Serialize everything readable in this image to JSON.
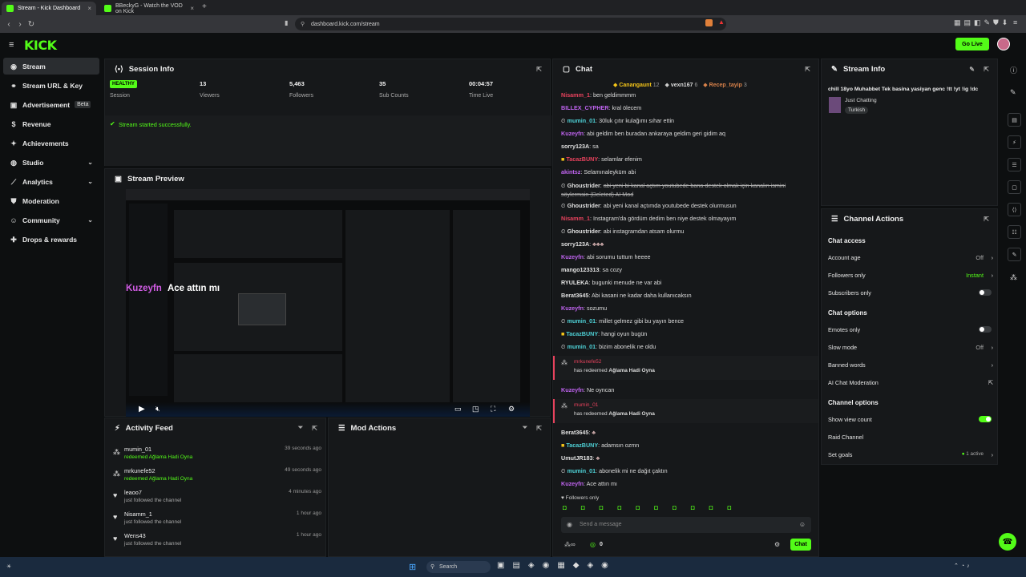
{
  "browser": {
    "tabs": [
      {
        "label": "Stream - Kick Dashboard"
      },
      {
        "label": "BBeckyG - Watch the VOD on Kick"
      }
    ],
    "url": "dashboard.kick.com/stream"
  },
  "header": {
    "logo": "KICK",
    "go_live": "Go Live"
  },
  "sidebar": {
    "items": [
      {
        "label": "Stream"
      },
      {
        "label": "Stream URL & Key"
      },
      {
        "label": "Advertisement",
        "badge": "Beta"
      },
      {
        "label": "Revenue"
      },
      {
        "label": "Achievements"
      },
      {
        "label": "Studio"
      },
      {
        "label": "Analytics"
      },
      {
        "label": "Moderation"
      },
      {
        "label": "Community"
      },
      {
        "label": "Drops & rewards"
      }
    ]
  },
  "session": {
    "title": "Session Info",
    "status_badge": "HEALTHY",
    "status_label": "Session",
    "viewers": "13",
    "viewers_label": "Viewers",
    "followers": "5,463",
    "followers_label": "Followers",
    "subs": "35",
    "subs_label": "Sub Counts",
    "time": "00:04:57",
    "time_label": "Time Live",
    "message": "Stream started successfully."
  },
  "preview": {
    "title": "Stream Preview",
    "overlay_user": "Kuzeyfn",
    "overlay_text": "Ace attın mı"
  },
  "activity": {
    "title": "Activity Feed",
    "items": [
      {
        "name": "mumin_01",
        "sub": "redeemed Ağlama Hadi Oyna",
        "time": "39 seconds ago"
      },
      {
        "name": "mrkunefe52",
        "sub": "redeemed Ağlama Hadi Oyna",
        "time": "49 seconds ago"
      },
      {
        "name": "leaoo7",
        "sub": "just followed the channel",
        "time": "4 minutes ago"
      },
      {
        "name": "Nisamm_1",
        "sub": "just followed the channel",
        "time": "1 hour ago"
      },
      {
        "name": "Wens43",
        "sub": "just followed the channel",
        "time": "1 hour ago"
      }
    ]
  },
  "mod": {
    "title": "Mod Actions"
  },
  "chat": {
    "title": "Chat",
    "top_gifters": [
      {
        "name": "Canangaunt",
        "count": "12"
      },
      {
        "name": "vexn167",
        "count": "6"
      },
      {
        "name": "Recep_tayip",
        "count": "3"
      }
    ],
    "messages": [
      {
        "user": "Nisamm_1",
        "text": "ben geldimmmm"
      },
      {
        "user": "BILLEX_CYPHER",
        "text": "kral ölecem"
      },
      {
        "user": "mumin_01",
        "text": "30luk çıtır kulağımı sıhar ettin"
      },
      {
        "user": "Kuzeyfn",
        "text": "abi geldim ben buradan ankaraya geldim geri gidim aq"
      },
      {
        "user": "sorry123A",
        "text": "sa"
      },
      {
        "user": "TacazBUNY",
        "text": "selamlar efenim"
      },
      {
        "user": "akintsz",
        "text": "Selamınaleyküm abi"
      },
      {
        "user": "Ghoustrider",
        "text": "abi yeni bi kanal açtım youtubede bana destek olmak için kanalın ismini söylermsin (Deleted) AI Mod"
      },
      {
        "user": "Ghoustrider",
        "text": "abi yeni kanal açtımda youtubede destek olurmusun"
      },
      {
        "user": "Nisamm_1",
        "text": "Instagram'da gördüm dedim ben niye destek olmayayım"
      },
      {
        "user": "Ghoustrider",
        "text": "abi instagramdan atsam olurmu"
      },
      {
        "user": "sorry123A",
        "text": ""
      },
      {
        "user": "Kuzeyfn",
        "text": "abi sorumu tuttum heeee"
      },
      {
        "user": "mango123313",
        "text": "sa cozy"
      },
      {
        "user": "RYULEKA",
        "text": "bugunki menude ne var abi"
      },
      {
        "user": "Berat3645",
        "text": "Abi kasani ne kadar daha kullanıcaksın"
      },
      {
        "user": "Kuzeyfn",
        "text": "sozumu"
      },
      {
        "user": "mumin_01",
        "text": "millet gelmez gibi bu yayın bence"
      },
      {
        "user": "TacazBUNY",
        "text": "hangi oyun bugün"
      },
      {
        "user": "mumin_01",
        "text": "bizim abonelik ne oldu"
      }
    ],
    "redeem1_user": "mrkunefe52",
    "redeem_text": "has redeemed",
    "redeem_reward": "Ağlama Hadi Oyna",
    "after1": {
      "user": "Kuzeyfn",
      "text": "Ne oyncan"
    },
    "redeem2_user": "mumin_01",
    "after2": [
      {
        "user": "Berat3645",
        "text": ""
      },
      {
        "user": "TacazBUNY",
        "text": "adamsın ozmn"
      },
      {
        "user": "UmutJR183",
        "text": ""
      },
      {
        "user": "mumin_01",
        "text": "abonelik mi ne dağıt çaktın"
      },
      {
        "user": "Kuzeyfn",
        "text": "Ace attın mı"
      }
    ],
    "followers_only": "Followers only",
    "placeholder": "Send a message",
    "points": "0",
    "send": "Chat"
  },
  "stream_info": {
    "title": "Stream Info",
    "stream_title": "chill 18yo Muhabbet Tek basina yasiyan genc !tt !yt !ig !dc",
    "category": "Just Chatting",
    "tag": "Turkish"
  },
  "channel_actions": {
    "title": "Channel Actions",
    "chat_access": "Chat access",
    "account_age": "Account age",
    "account_age_val": "Off",
    "followers_only": "Followers only",
    "followers_only_val": "Instant",
    "subscribers_only": "Subscribers only",
    "chat_options": "Chat options",
    "emotes_only": "Emotes only",
    "slow_mode": "Slow mode",
    "slow_mode_val": "Off",
    "banned_words": "Banned words",
    "ai_mod": "AI Chat Moderation",
    "channel_options": "Channel options",
    "show_view_count": "Show view count",
    "raid": "Raid Channel",
    "set_goals": "Set goals",
    "set_goals_val": "1 active"
  },
  "taskbar": {
    "search": "Search"
  },
  "colors": {
    "accent": "#53fc18",
    "bg": "#0d0f10",
    "panel": "#16181a"
  }
}
